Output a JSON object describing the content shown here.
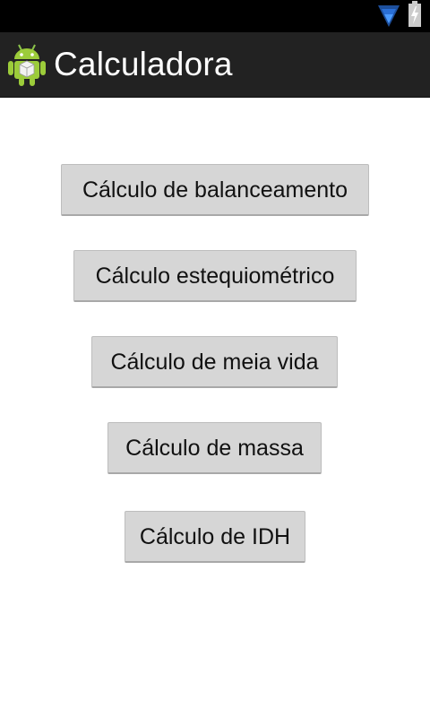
{
  "status_bar": {
    "icons": [
      "wifi-icon",
      "battery-charging-icon"
    ],
    "wifi_color": "#2a6fd6"
  },
  "action_bar": {
    "title": "Calculadora",
    "icon": "android-app-icon",
    "background": "#222222"
  },
  "main": {
    "buttons": [
      {
        "label": "Cálculo de balanceamento"
      },
      {
        "label": "Cálculo estequiométrico"
      },
      {
        "label": "Cálculo de meia vida"
      },
      {
        "label": "Cálculo de massa"
      },
      {
        "label": "Cálculo de IDH"
      }
    ]
  }
}
